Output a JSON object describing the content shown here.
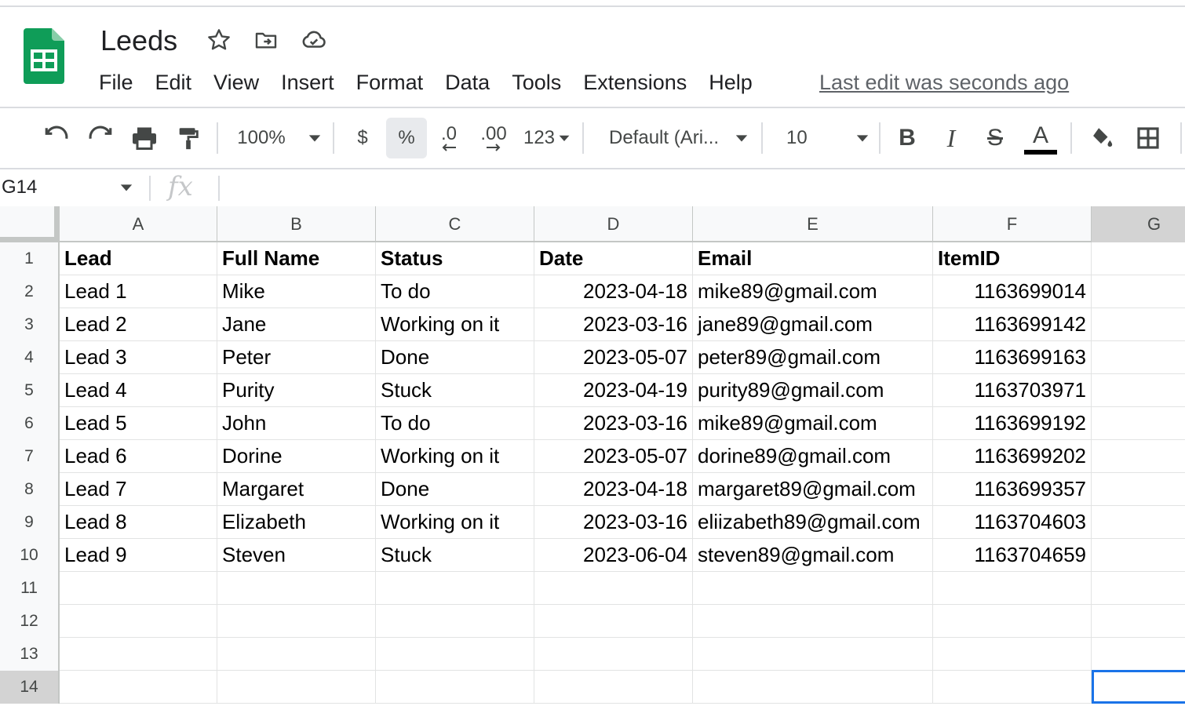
{
  "doc": {
    "title": "Leeds",
    "last_edit": "Last edit was seconds ago"
  },
  "menu": [
    "File",
    "Edit",
    "View",
    "Insert",
    "Format",
    "Data",
    "Tools",
    "Extensions",
    "Help"
  ],
  "toolbar": {
    "zoom": "100%",
    "currency": "$",
    "percent": "%",
    "decrease_decimal": ".0",
    "increase_decimal": ".00",
    "more_formats": "123",
    "font": "Default (Ari...",
    "font_size": "10",
    "bold": "B",
    "italic": "I",
    "strike": "S",
    "text_color_label": "A",
    "text_color": "#000000"
  },
  "formula_bar": {
    "name_box": "G14",
    "fx": "fx",
    "value": ""
  },
  "colors": {
    "sheets_green": "#0f9d58",
    "selection": "#1a73e8"
  },
  "grid": {
    "columns": [
      "A",
      "B",
      "C",
      "D",
      "E",
      "F",
      "G"
    ],
    "rows": [
      [
        "Lead",
        "Full Name",
        "Status",
        "Date",
        "Email",
        "ItemID",
        ""
      ],
      [
        "Lead 1",
        "Mike",
        "To do",
        "2023-04-18",
        "mike89@gmail.com",
        "1163699014",
        ""
      ],
      [
        "Lead 2",
        "Jane",
        "Working on it",
        "2023-03-16",
        "jane89@gmail.com",
        "1163699142",
        ""
      ],
      [
        "Lead 3",
        "Peter",
        "Done",
        "2023-05-07",
        "peter89@gmail.com",
        "1163699163",
        ""
      ],
      [
        "Lead 4",
        "Purity",
        "Stuck",
        "2023-04-19",
        "purity89@gmail.com",
        "1163703971",
        ""
      ],
      [
        "Lead 5",
        "John",
        "To do",
        "2023-03-16",
        "mike89@gmail.com",
        "1163699192",
        ""
      ],
      [
        "Lead 6",
        "Dorine",
        "Working on it",
        "2023-05-07",
        "dorine89@gmail.com",
        "1163699202",
        ""
      ],
      [
        "Lead 7",
        "Margaret",
        "Done",
        "2023-04-18",
        "margaret89@gmail.com",
        "1163699357",
        ""
      ],
      [
        "Lead 8",
        "Elizabeth",
        "Working on it",
        "2023-03-16",
        "eliizabeth89@gmail.com",
        "1163704603",
        ""
      ],
      [
        "Lead 9",
        "Steven",
        "Stuck",
        "2023-06-04",
        "steven89@gmail.com",
        "1163704659",
        ""
      ],
      [
        "",
        "",
        "",
        "",
        "",
        "",
        ""
      ],
      [
        "",
        "",
        "",
        "",
        "",
        "",
        ""
      ],
      [
        "",
        "",
        "",
        "",
        "",
        "",
        ""
      ],
      [
        "",
        "",
        "",
        "",
        "",
        "",
        ""
      ]
    ],
    "selected_cell": "G14"
  }
}
